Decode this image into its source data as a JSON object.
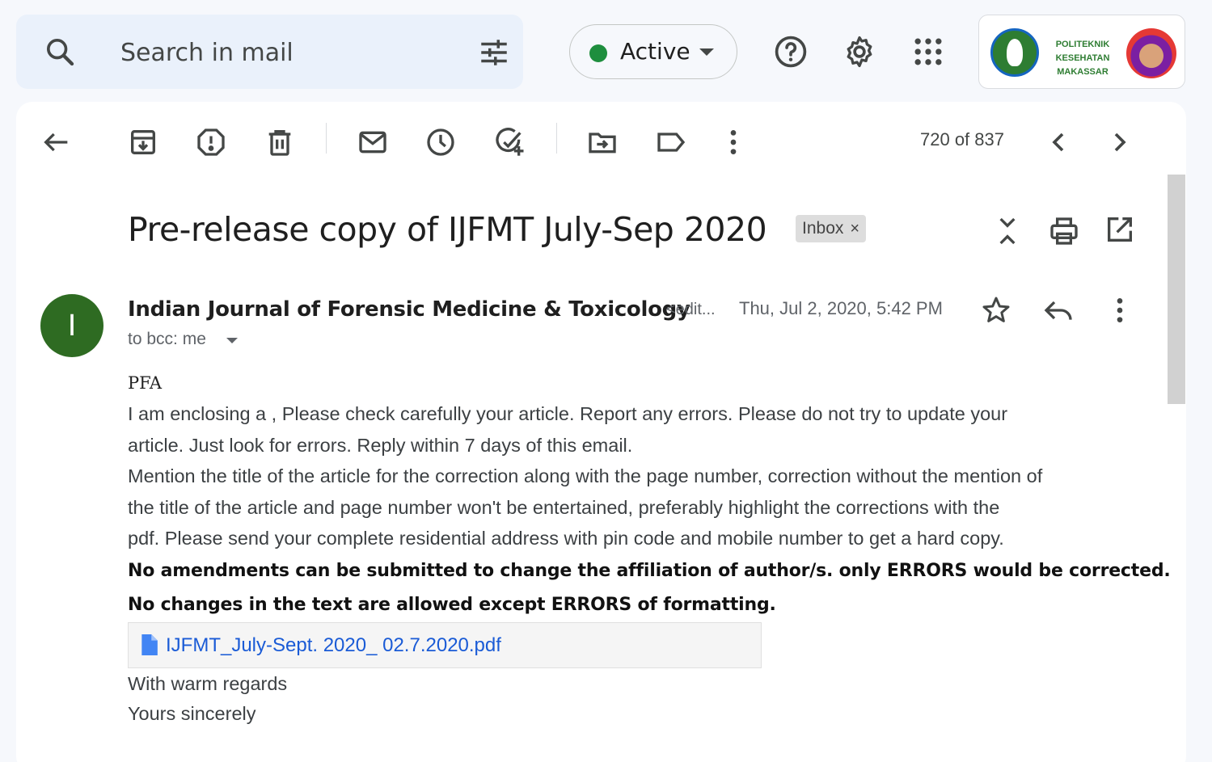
{
  "search": {
    "placeholder": "Search in mail"
  },
  "status": {
    "label": "Active",
    "color": "#1e8e3e"
  },
  "account": {
    "logo_text": "POLITEKNIK KESEHATAN MAKASSAR"
  },
  "toolbar": {
    "counter": "720 of 837"
  },
  "email": {
    "subject": "Pre-release copy of IJFMT July-Sep 2020",
    "label": "Inbox",
    "label_remove": "×",
    "sender_initial": "I",
    "sender_name": "Indian Journal of Forensic Medicine & Toxicology",
    "sender_email": "<edit...",
    "date": "Thu, Jul 2, 2020, 5:42 PM",
    "to": "to bcc: me",
    "body": {
      "l1": "PFA",
      "l2": " I am enclosing a , Please check carefully your article. Report any errors. Please do not try to update your",
      "l3": "article. Just look for errors. Reply within 7 days of this email.",
      "l4": "Mention the title of the article for the correction along with the page number,  correction without the mention of",
      "l5": "the title of the article and page number won't be entertained, preferably highlight the corrections with the",
      "l6": "pdf. Please send your complete residential address with pin code and mobile number to get a hard copy.",
      "l7": "No amendments can be submitted to change the affiliation of author/s. only ERRORS would be corrected.",
      "l8": "No changes in the text are allowed except ERRORS of formatting.",
      "attachment": "IJFMT_July-Sept. 2020_ 02.7.2020.pdf",
      "l9": "With warm regards",
      "l10": "Yours sincerely"
    }
  }
}
